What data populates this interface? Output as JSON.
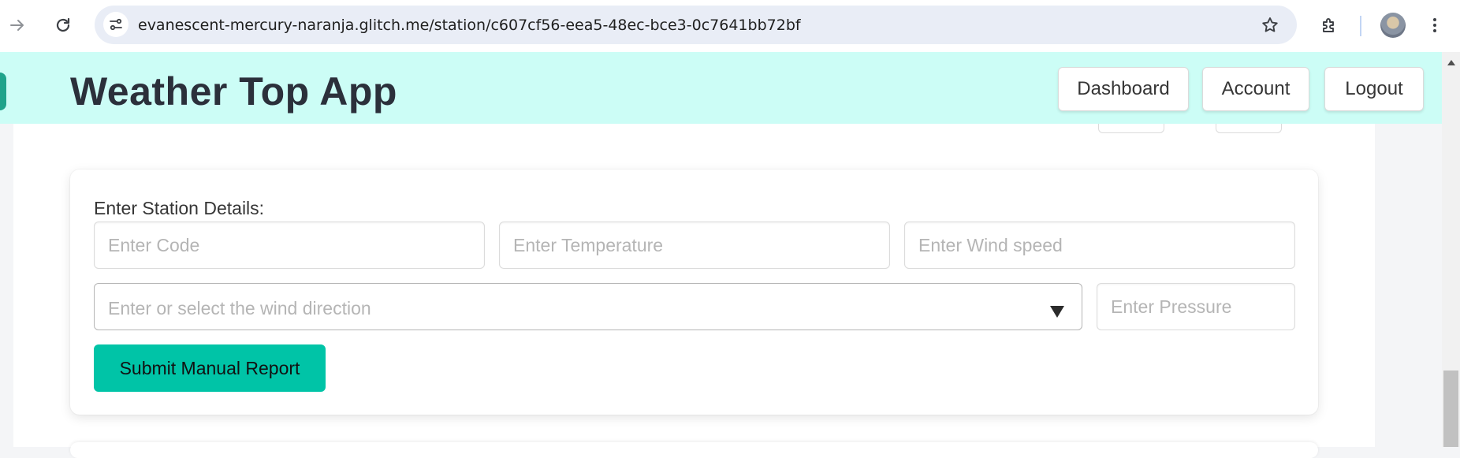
{
  "browser": {
    "url": "evanescent-mercury-naranja.glitch.me/station/c607cf56-eea5-48ec-bce3-0c7641bb72bf",
    "icons": [
      "forward-icon",
      "reload-icon",
      "site-info-icon",
      "bookmark-star-icon",
      "extensions-icon",
      "profile-avatar",
      "more-menu-icon"
    ]
  },
  "header": {
    "title": "Weather Top App",
    "nav": {
      "dashboard": "Dashboard",
      "account": "Account",
      "logout": "Logout"
    },
    "background_color": "#ccfdf6"
  },
  "form": {
    "label": "Enter Station Details:",
    "code_placeholder": "Enter Code",
    "temperature_placeholder": "Enter Temperature",
    "wind_speed_placeholder": "Enter Wind speed",
    "wind_direction_placeholder": "Enter or select the wind direction",
    "pressure_placeholder": "Enter Pressure",
    "submit_label": "Submit Manual Report",
    "submit_color": "#00c4a7"
  }
}
